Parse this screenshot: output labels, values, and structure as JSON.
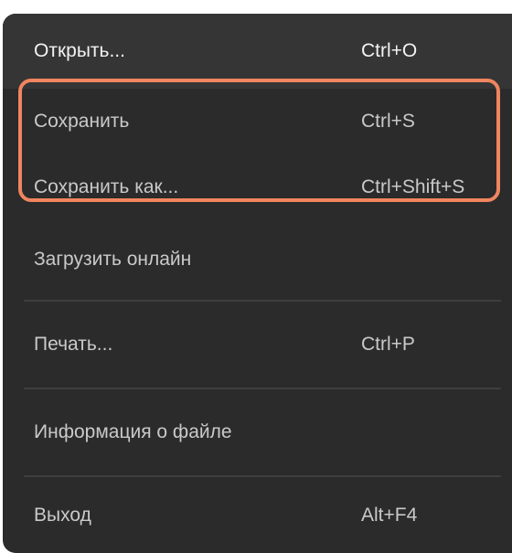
{
  "menu": {
    "items": [
      {
        "label": "Открыть...",
        "shortcut": "Ctrl+O"
      },
      {
        "label": "Сохранить",
        "shortcut": "Ctrl+S"
      },
      {
        "label": "Сохранить как...",
        "shortcut": "Ctrl+Shift+S"
      },
      {
        "label": "Загрузить онлайн",
        "shortcut": ""
      },
      {
        "label": "Печать...",
        "shortcut": "Ctrl+P"
      },
      {
        "label": "Информация о файле",
        "shortcut": ""
      },
      {
        "label": "Выход",
        "shortcut": "Alt+F4"
      }
    ]
  },
  "colors": {
    "menu_background": "#2b2b2b",
    "hover_background": "#353535",
    "text": "#c9c9c9",
    "highlight_outline": "#f0855f"
  }
}
